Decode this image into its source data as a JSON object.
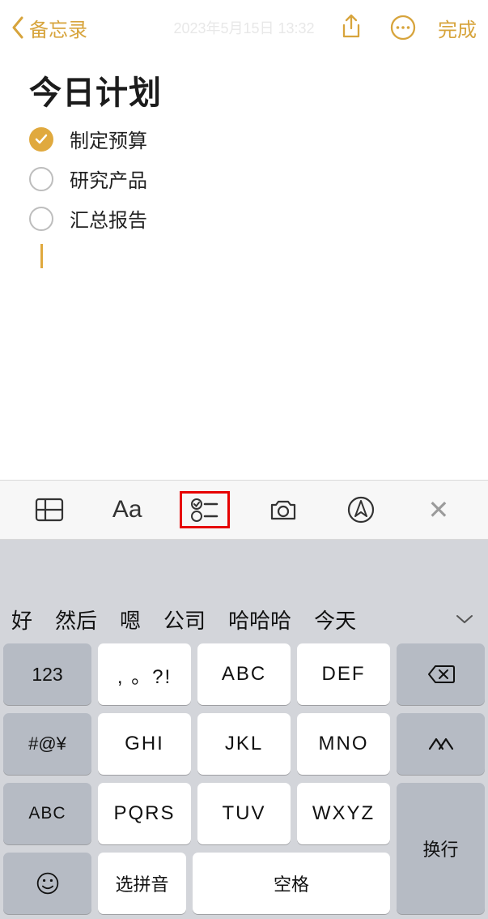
{
  "header": {
    "back_label": "备忘录",
    "timestamp": "2023年5月15日 13:32",
    "done_label": "完成"
  },
  "note": {
    "title": "今日计划",
    "items": [
      {
        "text": "制定预算",
        "checked": true
      },
      {
        "text": "研究产品",
        "checked": false
      },
      {
        "text": "汇总报告",
        "checked": false
      }
    ]
  },
  "toolbar": {
    "aa_label": "Aa"
  },
  "keyboard": {
    "candidates": [
      "好",
      "然后",
      "嗯",
      "公司",
      "哈哈哈",
      "今天"
    ],
    "row1": {
      "num": "123",
      "keys": [
        ", 。?!",
        "ABC",
        "DEF"
      ]
    },
    "row2": {
      "sym": "#@¥",
      "keys": [
        "GHI",
        "JKL",
        "MNO"
      ],
      "face": "^^"
    },
    "row3": {
      "abc": "ABC",
      "keys": [
        "PQRS",
        "TUV",
        "WXYZ"
      ]
    },
    "row4": {
      "pinyin": "选拼音",
      "space": "空格"
    },
    "return": "换行"
  }
}
